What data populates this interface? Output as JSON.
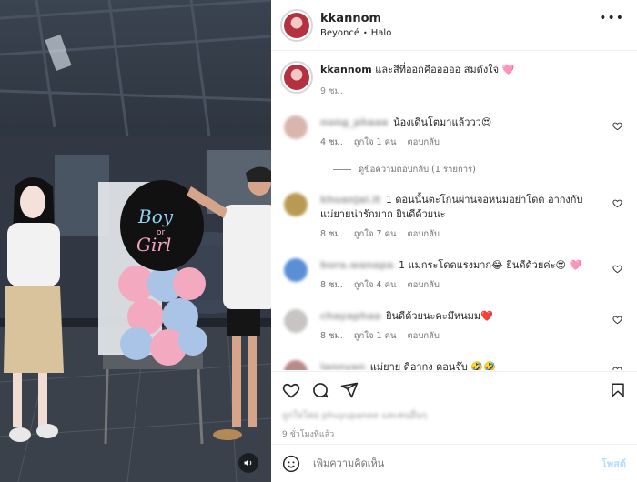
{
  "post": {
    "username": "kkannom",
    "audio_artist": "Beyoncé",
    "audio_track": "Halo",
    "caption_user": "kkannom",
    "caption_text": "และสีที่ออกคือออออ สมดังใจ 🩷",
    "caption_time": "9 ชม.",
    "balloon_top": "Boy",
    "balloon_mid": "or",
    "balloon_bottom": "Girl"
  },
  "comments": [
    {
      "user": "nong_phaaa",
      "text": "น้องเดินโตมาแล้ววว😍",
      "time": "4 ชม.",
      "likes": "ถูกใจ 1 คน",
      "reply": "ตอบกลับ",
      "avatar_color": "#d8b6ae"
    },
    {
      "user": "khuanjai.it",
      "text": "1 ดอนนั้นตะโกนผ่านจอหนมอย่าโดด อากงกับแม่ยายน่ารักมาก ยินดีด้วยนะ",
      "time": "8 ชม.",
      "likes": "ถูกใจ 7 คน",
      "reply": "ตอบกลับ",
      "avatar_color": "#b89a52"
    },
    {
      "user": "bora.wanapa",
      "text": "1 แม่กระโดดแรงมาก😂 ยินดีด้วยค่ะ😍 🩷",
      "time": "8 ชม.",
      "likes": "ถูกใจ 4 คน",
      "reply": "ตอบกลับ",
      "avatar_color": "#5a8fd6"
    },
    {
      "user": "chayaphaa",
      "text": "ยินดีด้วยนะคะมึหนมม❤️",
      "time": "8 ชม.",
      "likes": "ถูกใจ 1 คน",
      "reply": "ตอบกลับ",
      "avatar_color": "#c9c4c4"
    },
    {
      "user": "lannyan",
      "text": "แม่ยาย ดีอากง ดอนจุ๊บ 🤣🤣",
      "time": "8 ชม.",
      "likes": "",
      "reply": "",
      "avatar_color": "#b98a86"
    }
  ],
  "replies_label": "ดูข้อความตอบกลับ (1 รายการ)",
  "likes_line": "ถูกใจโดย phuyupanee และคนอื่นๆ",
  "time_ago": "9 ชั่วโมงที่แล้ว",
  "input": {
    "placeholder": "เพิ่มความคิดเห็น"
  },
  "post_button": "โพสต์",
  "icons": {
    "like": "heart-icon",
    "comment": "comment-icon",
    "share": "send-icon",
    "save": "bookmark-icon",
    "emoji": "emoji-icon",
    "more": "more-icon",
    "mute": "volume-icon"
  },
  "colors": {
    "accent_link": "#b3dbff",
    "muted_text": "#8e8e8e",
    "balloon_pink": "#f3a9c0",
    "balloon_blue": "#a9c4e6"
  }
}
